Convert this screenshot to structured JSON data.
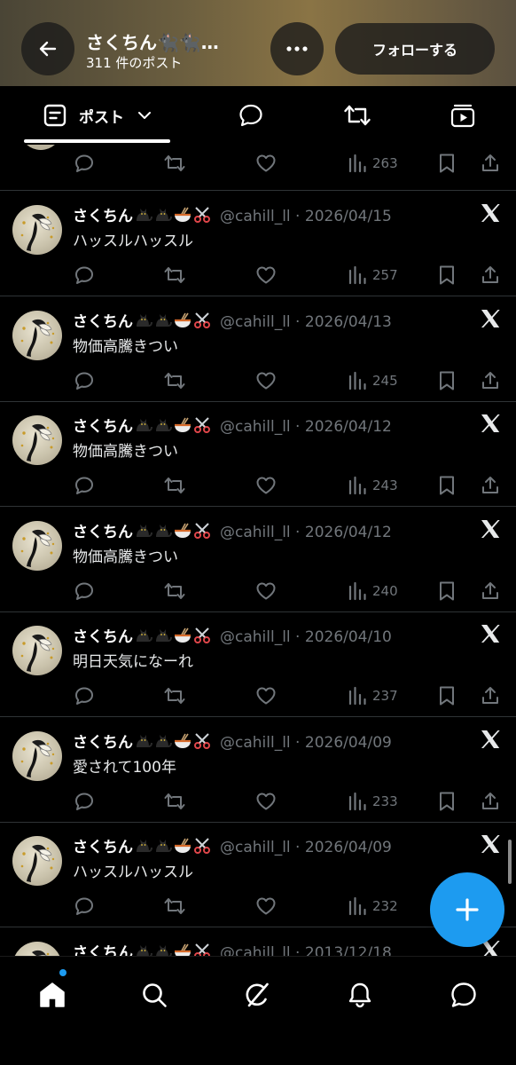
{
  "header": {
    "title": "さくちん🐈‍⬛🐈‍⬛…",
    "post_count": "311 件のポスト",
    "follow_label": "フォローする"
  },
  "tabs": [
    {
      "label": "ポスト",
      "icon": "posts-list-icon",
      "selected": true
    },
    {
      "icon": "reply-bubble-icon"
    },
    {
      "icon": "repost-icon"
    },
    {
      "icon": "video-play-icon"
    }
  ],
  "partial_post": {
    "views": "263"
  },
  "posts": [
    {
      "name": "さくちん",
      "handle": "@cahill_ll",
      "date": "2026/04/15",
      "text": "ハッスルハッスル",
      "views": "257"
    },
    {
      "name": "さくちん",
      "handle": "@cahill_ll",
      "date": "2026/04/13",
      "text": "物価高騰きつい",
      "views": "245"
    },
    {
      "name": "さくちん",
      "handle": "@cahill_ll",
      "date": "2026/04/12",
      "text": "物価高騰きつい",
      "views": "243"
    },
    {
      "name": "さくちん",
      "handle": "@cahill_ll",
      "date": "2026/04/12",
      "text": "物価高騰きつい",
      "views": "240"
    },
    {
      "name": "さくちん",
      "handle": "@cahill_ll",
      "date": "2026/04/10",
      "text": "明日天気になーれ",
      "views": "237"
    },
    {
      "name": "さくちん",
      "handle": "@cahill_ll",
      "date": "2026/04/09",
      "text": "愛されて100年",
      "views": "233"
    },
    {
      "name": "さくちん",
      "handle": "@cahill_ll",
      "date": "2026/04/09",
      "text": "ハッスルハッスル",
      "views": "232"
    },
    {
      "name": "さくちん",
      "handle": "@cahill_ll",
      "date": "2013/12/18",
      "text": "",
      "views": ""
    }
  ],
  "name_emojis": [
    "black-cat",
    "black-cat",
    "ramen-bowl",
    "scissors"
  ],
  "handle_date_separator": " · ",
  "bottom_nav": [
    {
      "icon": "home-icon",
      "active": true,
      "badge": true
    },
    {
      "icon": "search-icon"
    },
    {
      "icon": "grok-icon"
    },
    {
      "icon": "bell-icon"
    },
    {
      "icon": "chat-icon"
    }
  ],
  "colors": {
    "accent": "#1d9bf0",
    "muted": "#71767b",
    "divider": "#2f3336"
  }
}
